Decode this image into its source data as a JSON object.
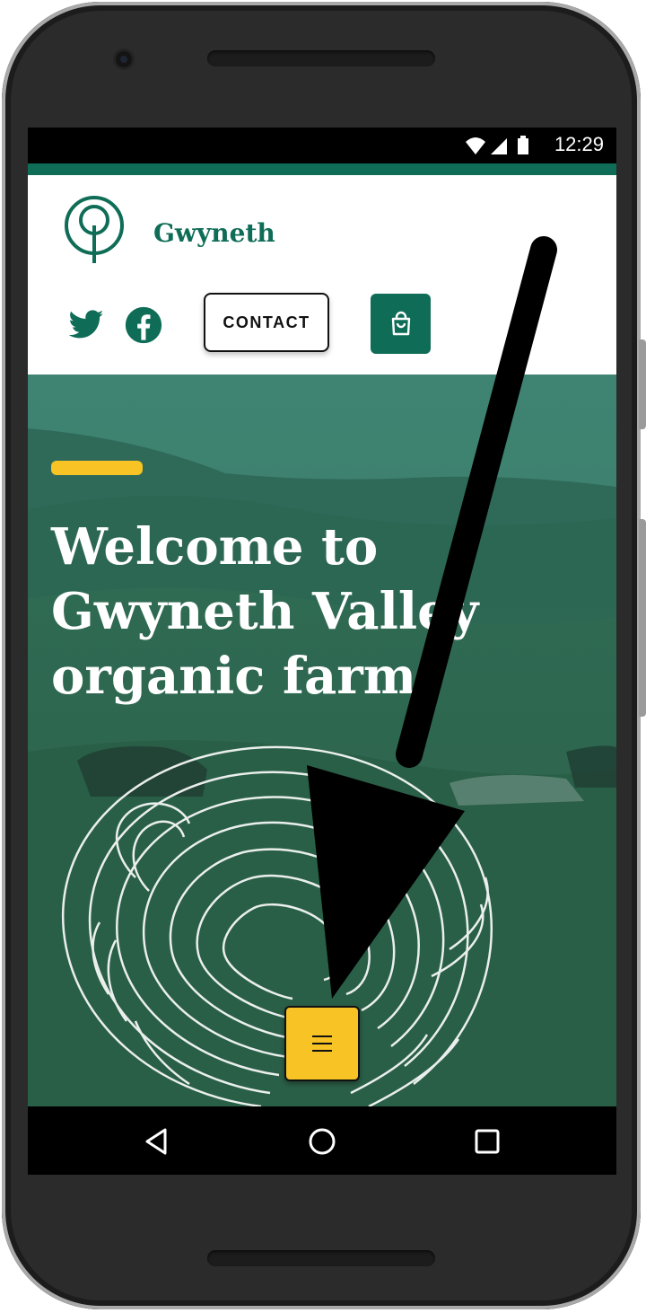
{
  "status_bar": {
    "time": "12:29",
    "icons": [
      "wifi-icon",
      "signal-icon",
      "battery-icon"
    ]
  },
  "header": {
    "brand_name": "Gwyneth",
    "logo_icon": "tree-logo-icon",
    "social_icons": [
      "twitter-icon",
      "facebook-icon"
    ],
    "contact_label": "CONTACT",
    "cart_icon": "shopping-bag-icon"
  },
  "hero": {
    "title_lines": [
      "Welcome to",
      "Gwyneth Valley",
      "organic farm"
    ],
    "menu_icon": "hamburger-menu-icon"
  },
  "nav_bar": {
    "keys": [
      "back-icon",
      "home-icon",
      "recents-icon"
    ]
  },
  "annotation": {
    "arrow": "arrow-annotation-icon"
  },
  "colors": {
    "brand_green": "#0f6d57",
    "accent_yellow": "#f7c325",
    "hero_overlay": "#2f6f5d",
    "phone_body": "#2b2b2b"
  }
}
